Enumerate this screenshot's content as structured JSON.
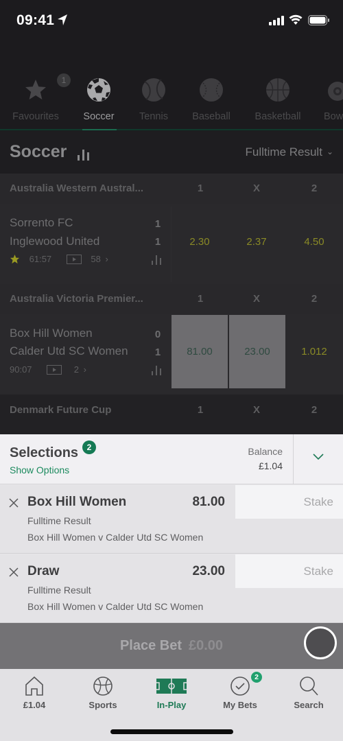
{
  "status_bar": {
    "time": "09:41"
  },
  "sports_nav": {
    "items": [
      {
        "label": "Favourites",
        "icon": "star-icon",
        "badge": "1"
      },
      {
        "label": "Soccer",
        "icon": "soccer-ball-icon",
        "active": true
      },
      {
        "label": "Tennis",
        "icon": "tennis-ball-icon"
      },
      {
        "label": "Baseball",
        "icon": "baseball-icon"
      },
      {
        "label": "Basketball",
        "icon": "basketball-icon"
      },
      {
        "label": "Bowls",
        "icon": "bowls-icon"
      }
    ]
  },
  "page": {
    "title": "Soccer",
    "market_selector": "Fulltime Result"
  },
  "competitions": [
    {
      "name": "Australia Western Austral...",
      "columns": [
        "1",
        "X",
        "2"
      ],
      "matches": [
        {
          "home": "Sorrento FC",
          "away": "Inglewood United",
          "home_score": "1",
          "away_score": "1",
          "time": "61:57",
          "markets": "58",
          "favourite": true,
          "odds": [
            "2.30",
            "2.37",
            "4.50"
          ]
        }
      ]
    },
    {
      "name": "Australia Victoria Premier...",
      "columns": [
        "1",
        "X",
        "2"
      ],
      "matches": [
        {
          "home": "Box Hill Women",
          "away": "Calder Utd SC Women",
          "home_score": "0",
          "away_score": "1",
          "time": "90:07",
          "markets": "2",
          "favourite": false,
          "odds": [
            "81.00",
            "23.00",
            "1.012"
          ],
          "selected": [
            0,
            1
          ]
        }
      ]
    },
    {
      "name": "Denmark Future Cup",
      "columns": [
        "1",
        "X",
        "2"
      ]
    }
  ],
  "betslip": {
    "title": "Selections",
    "count": "2",
    "show_options": "Show Options",
    "balance_label": "Balance",
    "balance_value": "£1.04",
    "bets": [
      {
        "selection": "Box Hill Women",
        "price": "81.00",
        "market": "Fulltime Result",
        "event": "Box Hill Women v Calder Utd SC Women",
        "stake_placeholder": "Stake"
      },
      {
        "selection": "Draw",
        "price": "23.00",
        "market": "Fulltime Result",
        "event": "Box Hill Women v Calder Utd SC Women",
        "stake_placeholder": "Stake"
      }
    ],
    "place_bet_label": "Place Bet",
    "place_bet_amount": "£0.00"
  },
  "tabbar": {
    "items": [
      {
        "label": "£1.04",
        "icon": "home-icon"
      },
      {
        "label": "Sports",
        "icon": "sports-ball-icon"
      },
      {
        "label": "In-Play",
        "icon": "pitch-icon",
        "active": true
      },
      {
        "label": "My Bets",
        "icon": "checkmark-circle-icon",
        "badge": "2"
      },
      {
        "label": "Search",
        "icon": "search-icon"
      }
    ]
  },
  "colors": {
    "accent_green": "#1f7a56",
    "odds_yellow": "#8a8a26",
    "badge_green": "#21a06e"
  }
}
